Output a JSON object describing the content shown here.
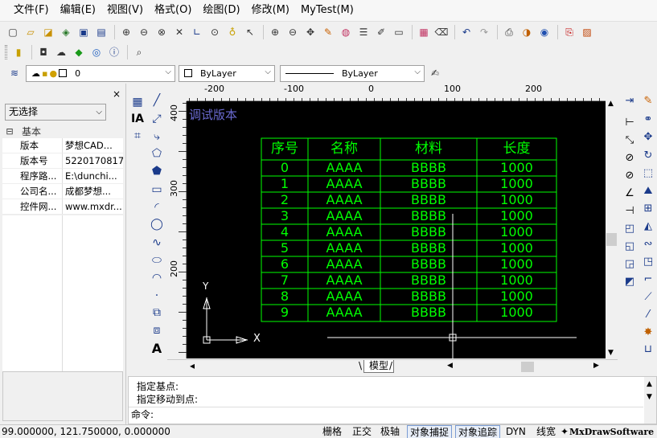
{
  "menu": [
    "文件(F)",
    "编辑(E)",
    "视图(V)",
    "格式(O)",
    "绘图(D)",
    "修改(M)",
    "MyTest(M)"
  ],
  "layer": {
    "name": "0",
    "color": "ByLayer",
    "linetype": "ByLayer"
  },
  "props": {
    "close": "×",
    "selection": "无选择",
    "category": "基本",
    "toggle": "⊟",
    "rows": [
      {
        "key": "版本",
        "value": "梦想CAD..."
      },
      {
        "key": "版本号",
        "value": "5220170817"
      },
      {
        "key": "程序路...",
        "value": "E:\\dunchi..."
      },
      {
        "key": "公司名...",
        "value": "成都梦想..."
      },
      {
        "key": "控件网...",
        "value": "www.mxdr..."
      }
    ]
  },
  "ruler": {
    "top": [
      "-200",
      "-100",
      "0",
      "100",
      "200"
    ],
    "left": [
      "400",
      "300",
      "200"
    ]
  },
  "drawing": {
    "label": "调试版本",
    "headers": [
      "序号",
      "名称",
      "材料",
      "长度"
    ],
    "rows": [
      [
        "0",
        "AAAA",
        "BBBB",
        "1000"
      ],
      [
        "1",
        "AAAA",
        "BBBB",
        "1000"
      ],
      [
        "2",
        "AAAA",
        "BBBB",
        "1000"
      ],
      [
        "3",
        "AAAA",
        "BBBB",
        "1000"
      ],
      [
        "4",
        "AAAA",
        "BBBB",
        "1000"
      ],
      [
        "5",
        "AAAA",
        "BBBB",
        "1000"
      ],
      [
        "6",
        "AAAA",
        "BBBB",
        "1000"
      ],
      [
        "7",
        "AAAA",
        "BBBB",
        "1000"
      ],
      [
        "8",
        "AAAA",
        "BBBB",
        "1000"
      ],
      [
        "9",
        "AAAA",
        "BBBB",
        "1000"
      ]
    ],
    "axis_x": "X",
    "axis_y": "Y"
  },
  "tabs": {
    "model": "模型"
  },
  "command": {
    "lines": [
      "指定基点:",
      "指定移动到点:"
    ],
    "prompt": "命令:"
  },
  "status": {
    "coords": "99.000000,  121.750000,  0.000000",
    "buttons": [
      {
        "label": "栅格",
        "on": false
      },
      {
        "label": "正交",
        "on": false
      },
      {
        "label": "极轴",
        "on": false
      },
      {
        "label": "对象捕捉",
        "on": true
      },
      {
        "label": "对象追踪",
        "on": true
      },
      {
        "label": "DYN",
        "on": false
      },
      {
        "label": "线宽",
        "on": false
      }
    ],
    "brand": "MxDrawSoftware"
  },
  "colors": {
    "table": "#00ff00",
    "label": "#6a6ad0",
    "canvas": "#000000"
  }
}
